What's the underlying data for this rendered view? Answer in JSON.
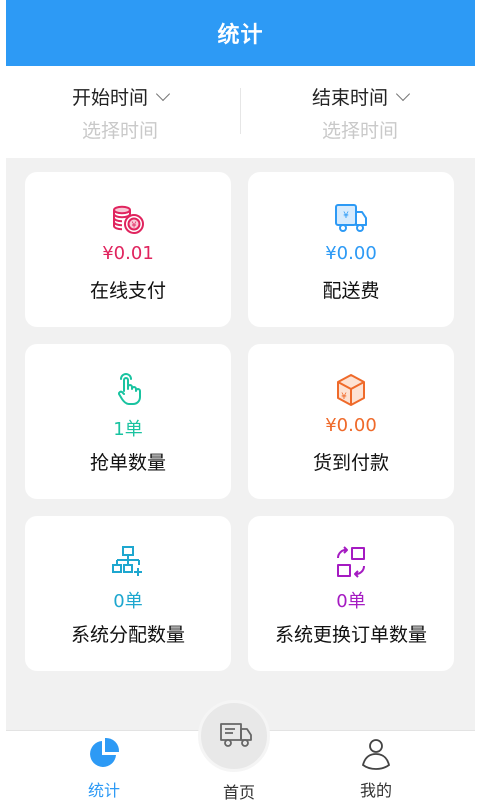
{
  "header": {
    "title": "统计"
  },
  "filter": {
    "start": {
      "label": "开始时间",
      "placeholder": "选择时间"
    },
    "end": {
      "label": "结束时间",
      "placeholder": "选择时间"
    }
  },
  "cards": [
    {
      "value": "¥0.01",
      "label": "在线支付",
      "icon": "coins-icon",
      "color": "#e0245e"
    },
    {
      "value": "¥0.00",
      "label": "配送费",
      "icon": "delivery-truck-icon",
      "color": "#2d9af5"
    },
    {
      "value": "1单",
      "label": "抢单数量",
      "icon": "tap-hand-icon",
      "color": "#19c3a0"
    },
    {
      "value": "¥0.00",
      "label": "货到付款",
      "icon": "package-icon",
      "color": "#ef6a2a"
    },
    {
      "value": "0单",
      "label": "系统分配数量",
      "icon": "hierarchy-icon",
      "color": "#1ea7cf"
    },
    {
      "value": "0单",
      "label": "系统更换订单数量",
      "icon": "swap-orders-icon",
      "color": "#a51bc2"
    }
  ],
  "tabbar": {
    "stats": {
      "label": "统计",
      "icon": "pie-chart-icon",
      "color": "#2d9af5"
    },
    "home": {
      "label": "首页",
      "icon": "truck-icon"
    },
    "mine": {
      "label": "我的",
      "icon": "user-icon"
    }
  }
}
